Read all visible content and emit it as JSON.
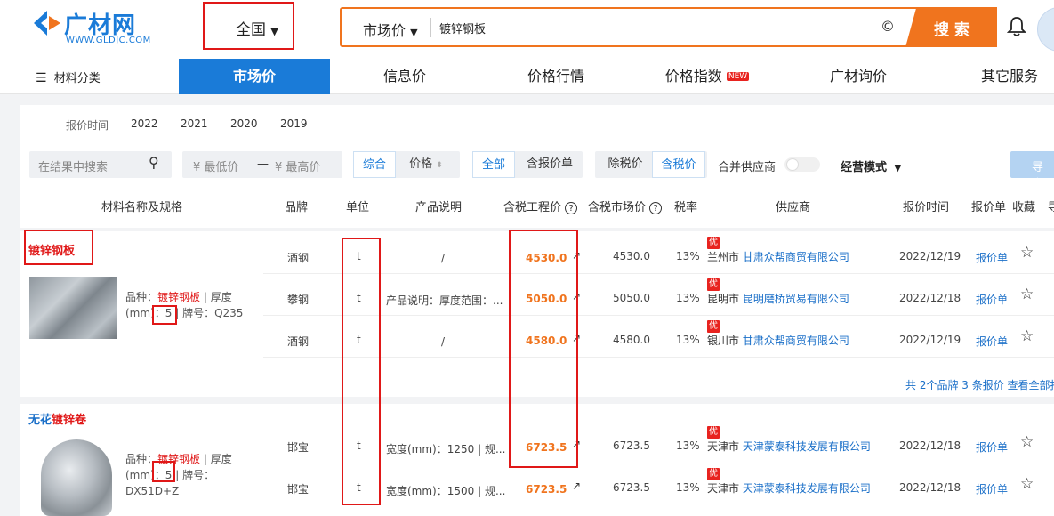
{
  "header": {
    "logo_text": "广材网",
    "logo_url_text": "WWW.GLDJC.COM",
    "region": "全国",
    "search_type": "市场价",
    "search_value": "镀锌钢板",
    "search_clear_icon": "©",
    "search_button": "搜 索"
  },
  "nav": {
    "category": "材料分类",
    "items": [
      "市场价",
      "信息价",
      "价格行情",
      "价格指数",
      "广材询价",
      "其它服务"
    ],
    "new_badge": "NEW"
  },
  "filters": {
    "date_label": "报价时间",
    "years": [
      "2022",
      "2021",
      "2020",
      "2019"
    ],
    "search_placeholder": "在结果中搜索",
    "min_price_placeholder": "¥ 最低价",
    "dash": "—",
    "max_price_placeholder": "¥ 最高价",
    "sort_comprehensive": "综合",
    "sort_price": "价格",
    "all": "全部",
    "with_quote": "含报价单",
    "excl_tax": "除税价",
    "incl_tax": "含税价",
    "merge_supplier": "合并供应商",
    "business_mode": "经营模式",
    "export": "导出"
  },
  "table": {
    "headers": [
      "材料名称及规格",
      "品牌",
      "单位",
      "产品说明",
      "含税工程价",
      "含税市场价",
      "税率",
      "供应商",
      "报价时间",
      "报价单",
      "收藏",
      "导"
    ],
    "help_icon": "?"
  },
  "groups": [
    {
      "title": "镀锌钢板",
      "title_prefix": "",
      "spec_variety_label": "品种：",
      "spec_variety": "镀锌钢板",
      "spec_thickness": "| 厚度(mm)：5 |",
      "spec_grade": "牌号：Q235",
      "rows": [
        {
          "brand": "酒钢",
          "unit": "t",
          "desc": "/",
          "eng_price": "4530.0",
          "mkt_price": "4530.0",
          "tax": "13%",
          "badge": "优",
          "city": "兰州市",
          "supplier": "甘肃众帮商贸有限公司",
          "date": "2022/12/19",
          "quote": "报价单"
        },
        {
          "brand": "攀钢",
          "unit": "t",
          "desc": "产品说明：厚度范围：...",
          "eng_price": "5050.0",
          "mkt_price": "5050.0",
          "tax": "13%",
          "badge": "优",
          "city": "昆明市",
          "supplier": "昆明磨桥贸易有限公司",
          "date": "2022/12/18",
          "quote": "报价单"
        },
        {
          "brand": "酒钢",
          "unit": "t",
          "desc": "/",
          "eng_price": "4580.0",
          "mkt_price": "4580.0",
          "tax": "13%",
          "badge": "优",
          "city": "银川市",
          "supplier": "甘肃众帮商贸有限公司",
          "date": "2022/12/19",
          "quote": "报价单"
        }
      ],
      "summary": "共 2个品牌 3 条报价 查看全部报"
    },
    {
      "title": "镀锌卷",
      "title_prefix": "无花",
      "spec_variety_label": "品种：",
      "spec_variety": "镀锌钢板",
      "spec_thickness": "| 厚度(mm)：5 |",
      "spec_grade": "牌号：DX51D+Z",
      "rows": [
        {
          "brand": "邯宝",
          "unit": "t",
          "desc": "宽度(mm)：1250 | 规...",
          "eng_price": "6723.5",
          "mkt_price": "6723.5",
          "tax": "13%",
          "badge": "优",
          "city": "天津市",
          "supplier": "天津蒙泰科技发展有限公司",
          "date": "2022/12/18",
          "quote": "报价单"
        },
        {
          "brand": "邯宝",
          "unit": "t",
          "desc": "宽度(mm)：1500 | 规...",
          "eng_price": "6723.5",
          "mkt_price": "6723.5",
          "tax": "13%",
          "badge": "优",
          "city": "天津市",
          "supplier": "天津蒙泰科技发展有限公司",
          "date": "2022/12/18",
          "quote": "报价单"
        }
      ]
    }
  ],
  "colors": {
    "primary": "#1a7bd8",
    "orange": "#f0741e",
    "red_box": "#e01818",
    "link": "#1a6fc8"
  }
}
